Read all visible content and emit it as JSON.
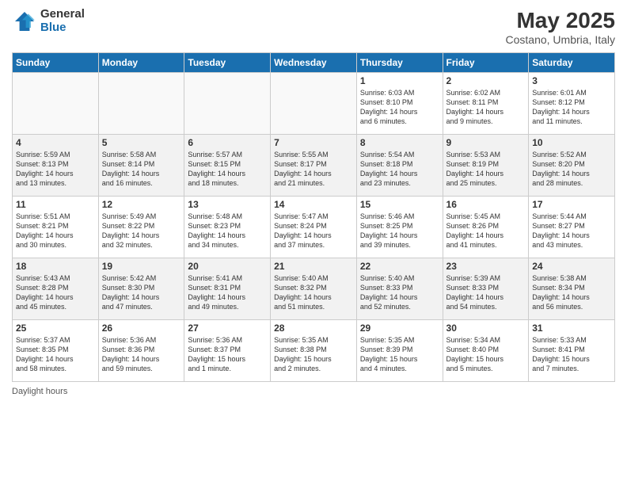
{
  "header": {
    "logo_general": "General",
    "logo_blue": "Blue",
    "title": "May 2025",
    "subtitle": "Costano, Umbria, Italy"
  },
  "days_of_week": [
    "Sunday",
    "Monday",
    "Tuesday",
    "Wednesday",
    "Thursday",
    "Friday",
    "Saturday"
  ],
  "legend": "Daylight hours",
  "weeks": [
    [
      {
        "day": "",
        "info": ""
      },
      {
        "day": "",
        "info": ""
      },
      {
        "day": "",
        "info": ""
      },
      {
        "day": "",
        "info": ""
      },
      {
        "day": "1",
        "info": "Sunrise: 6:03 AM\nSunset: 8:10 PM\nDaylight: 14 hours\nand 6 minutes."
      },
      {
        "day": "2",
        "info": "Sunrise: 6:02 AM\nSunset: 8:11 PM\nDaylight: 14 hours\nand 9 minutes."
      },
      {
        "day": "3",
        "info": "Sunrise: 6:01 AM\nSunset: 8:12 PM\nDaylight: 14 hours\nand 11 minutes."
      }
    ],
    [
      {
        "day": "4",
        "info": "Sunrise: 5:59 AM\nSunset: 8:13 PM\nDaylight: 14 hours\nand 13 minutes."
      },
      {
        "day": "5",
        "info": "Sunrise: 5:58 AM\nSunset: 8:14 PM\nDaylight: 14 hours\nand 16 minutes."
      },
      {
        "day": "6",
        "info": "Sunrise: 5:57 AM\nSunset: 8:15 PM\nDaylight: 14 hours\nand 18 minutes."
      },
      {
        "day": "7",
        "info": "Sunrise: 5:55 AM\nSunset: 8:17 PM\nDaylight: 14 hours\nand 21 minutes."
      },
      {
        "day": "8",
        "info": "Sunrise: 5:54 AM\nSunset: 8:18 PM\nDaylight: 14 hours\nand 23 minutes."
      },
      {
        "day": "9",
        "info": "Sunrise: 5:53 AM\nSunset: 8:19 PM\nDaylight: 14 hours\nand 25 minutes."
      },
      {
        "day": "10",
        "info": "Sunrise: 5:52 AM\nSunset: 8:20 PM\nDaylight: 14 hours\nand 28 minutes."
      }
    ],
    [
      {
        "day": "11",
        "info": "Sunrise: 5:51 AM\nSunset: 8:21 PM\nDaylight: 14 hours\nand 30 minutes."
      },
      {
        "day": "12",
        "info": "Sunrise: 5:49 AM\nSunset: 8:22 PM\nDaylight: 14 hours\nand 32 minutes."
      },
      {
        "day": "13",
        "info": "Sunrise: 5:48 AM\nSunset: 8:23 PM\nDaylight: 14 hours\nand 34 minutes."
      },
      {
        "day": "14",
        "info": "Sunrise: 5:47 AM\nSunset: 8:24 PM\nDaylight: 14 hours\nand 37 minutes."
      },
      {
        "day": "15",
        "info": "Sunrise: 5:46 AM\nSunset: 8:25 PM\nDaylight: 14 hours\nand 39 minutes."
      },
      {
        "day": "16",
        "info": "Sunrise: 5:45 AM\nSunset: 8:26 PM\nDaylight: 14 hours\nand 41 minutes."
      },
      {
        "day": "17",
        "info": "Sunrise: 5:44 AM\nSunset: 8:27 PM\nDaylight: 14 hours\nand 43 minutes."
      }
    ],
    [
      {
        "day": "18",
        "info": "Sunrise: 5:43 AM\nSunset: 8:28 PM\nDaylight: 14 hours\nand 45 minutes."
      },
      {
        "day": "19",
        "info": "Sunrise: 5:42 AM\nSunset: 8:30 PM\nDaylight: 14 hours\nand 47 minutes."
      },
      {
        "day": "20",
        "info": "Sunrise: 5:41 AM\nSunset: 8:31 PM\nDaylight: 14 hours\nand 49 minutes."
      },
      {
        "day": "21",
        "info": "Sunrise: 5:40 AM\nSunset: 8:32 PM\nDaylight: 14 hours\nand 51 minutes."
      },
      {
        "day": "22",
        "info": "Sunrise: 5:40 AM\nSunset: 8:33 PM\nDaylight: 14 hours\nand 52 minutes."
      },
      {
        "day": "23",
        "info": "Sunrise: 5:39 AM\nSunset: 8:33 PM\nDaylight: 14 hours\nand 54 minutes."
      },
      {
        "day": "24",
        "info": "Sunrise: 5:38 AM\nSunset: 8:34 PM\nDaylight: 14 hours\nand 56 minutes."
      }
    ],
    [
      {
        "day": "25",
        "info": "Sunrise: 5:37 AM\nSunset: 8:35 PM\nDaylight: 14 hours\nand 58 minutes."
      },
      {
        "day": "26",
        "info": "Sunrise: 5:36 AM\nSunset: 8:36 PM\nDaylight: 14 hours\nand 59 minutes."
      },
      {
        "day": "27",
        "info": "Sunrise: 5:36 AM\nSunset: 8:37 PM\nDaylight: 15 hours\nand 1 minute."
      },
      {
        "day": "28",
        "info": "Sunrise: 5:35 AM\nSunset: 8:38 PM\nDaylight: 15 hours\nand 2 minutes."
      },
      {
        "day": "29",
        "info": "Sunrise: 5:35 AM\nSunset: 8:39 PM\nDaylight: 15 hours\nand 4 minutes."
      },
      {
        "day": "30",
        "info": "Sunrise: 5:34 AM\nSunset: 8:40 PM\nDaylight: 15 hours\nand 5 minutes."
      },
      {
        "day": "31",
        "info": "Sunrise: 5:33 AM\nSunset: 8:41 PM\nDaylight: 15 hours\nand 7 minutes."
      }
    ]
  ]
}
